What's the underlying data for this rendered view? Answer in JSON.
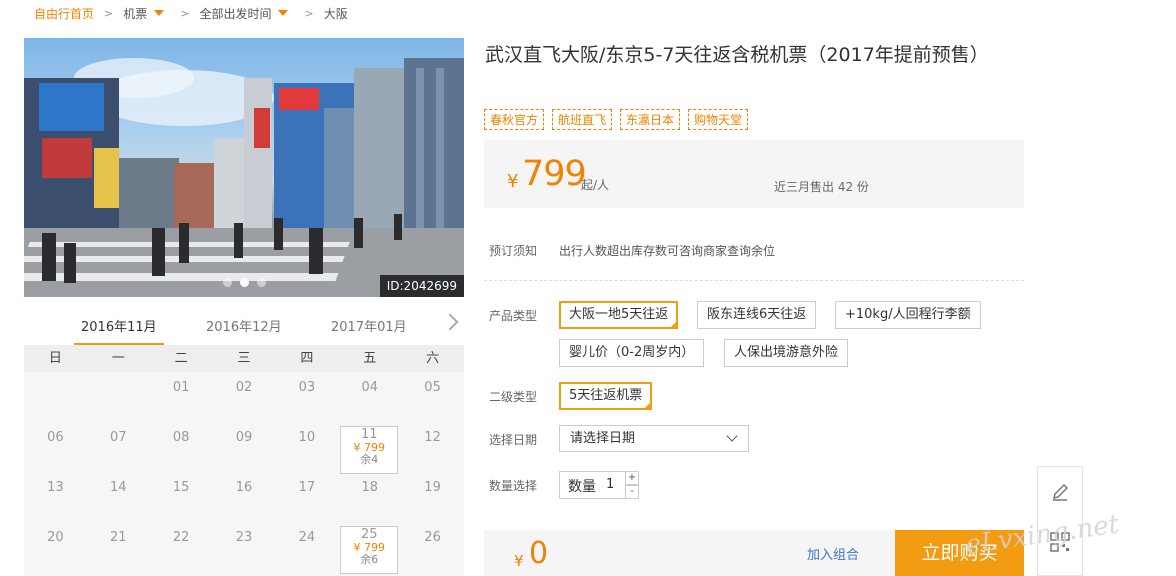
{
  "breadcrumb": {
    "home": "自由行首页",
    "category": "机票",
    "departure": "全部出发时间",
    "current": "大阪"
  },
  "gallery": {
    "image_id": "ID:2042699",
    "slide_count": 3,
    "active_slide": 1
  },
  "calendar": {
    "months": [
      "2016年11月",
      "2016年12月",
      "2017年01月"
    ],
    "active_month": "2016年11月",
    "weekdays": [
      "日",
      "一",
      "二",
      "三",
      "四",
      "五",
      "六"
    ],
    "weeks": [
      [
        {
          "day": ""
        },
        {
          "day": ""
        },
        {
          "day": "01"
        },
        {
          "day": "02"
        },
        {
          "day": "03"
        },
        {
          "day": "04"
        },
        {
          "day": "05"
        }
      ],
      [
        {
          "day": "06"
        },
        {
          "day": "07"
        },
        {
          "day": "08"
        },
        {
          "day": "09"
        },
        {
          "day": "10"
        },
        {
          "day": "11",
          "price": "¥ 799",
          "left": "余4"
        },
        {
          "day": "12"
        }
      ],
      [
        {
          "day": "13"
        },
        {
          "day": "14"
        },
        {
          "day": "15"
        },
        {
          "day": "16"
        },
        {
          "day": "17"
        },
        {
          "day": "18"
        },
        {
          "day": "19"
        }
      ],
      [
        {
          "day": "20"
        },
        {
          "day": "21"
        },
        {
          "day": "22"
        },
        {
          "day": "23"
        },
        {
          "day": "24"
        },
        {
          "day": "25",
          "price": "¥ 799",
          "left": "余6"
        },
        {
          "day": "26"
        }
      ]
    ]
  },
  "product": {
    "title": "武汉直飞大阪/东京5-7天往返含税机票（2017年提前预售）",
    "tags": [
      "春秋官方",
      "航班直飞",
      "东瀛日本",
      "购物天堂"
    ],
    "price_symbol": "¥",
    "price": "799",
    "price_unit": "起/人",
    "sold_text": "近三月售出 42 份"
  },
  "booking": {
    "notice_label": "预订须知",
    "notice_text": "出行人数超出库存数可咨询商家查询余位",
    "type_label": "产品类型",
    "types": [
      "大阪一地5天往返",
      "阪东连线6天往返",
      "+10kg/人回程行李额",
      "婴儿价（0-2周岁内）",
      "人保出境游意外险"
    ],
    "selected_type": "大阪一地5天往返",
    "subtype_label": "二级类型",
    "subtypes": [
      "5天往返机票"
    ],
    "date_label": "选择日期",
    "date_placeholder": "请选择日期",
    "qty_label": "数量选择",
    "qty_field_label": "数量",
    "qty_value": "1",
    "plus": "+",
    "minus": "-"
  },
  "footer": {
    "total_symbol": "¥",
    "total": "0",
    "add_combo": "加入组合",
    "buy_now": "立即购买"
  },
  "watermark": "eLvxing.net",
  "colors": {
    "accent": "#f08300",
    "button": "#f39c12",
    "link": "#3a76c4"
  }
}
